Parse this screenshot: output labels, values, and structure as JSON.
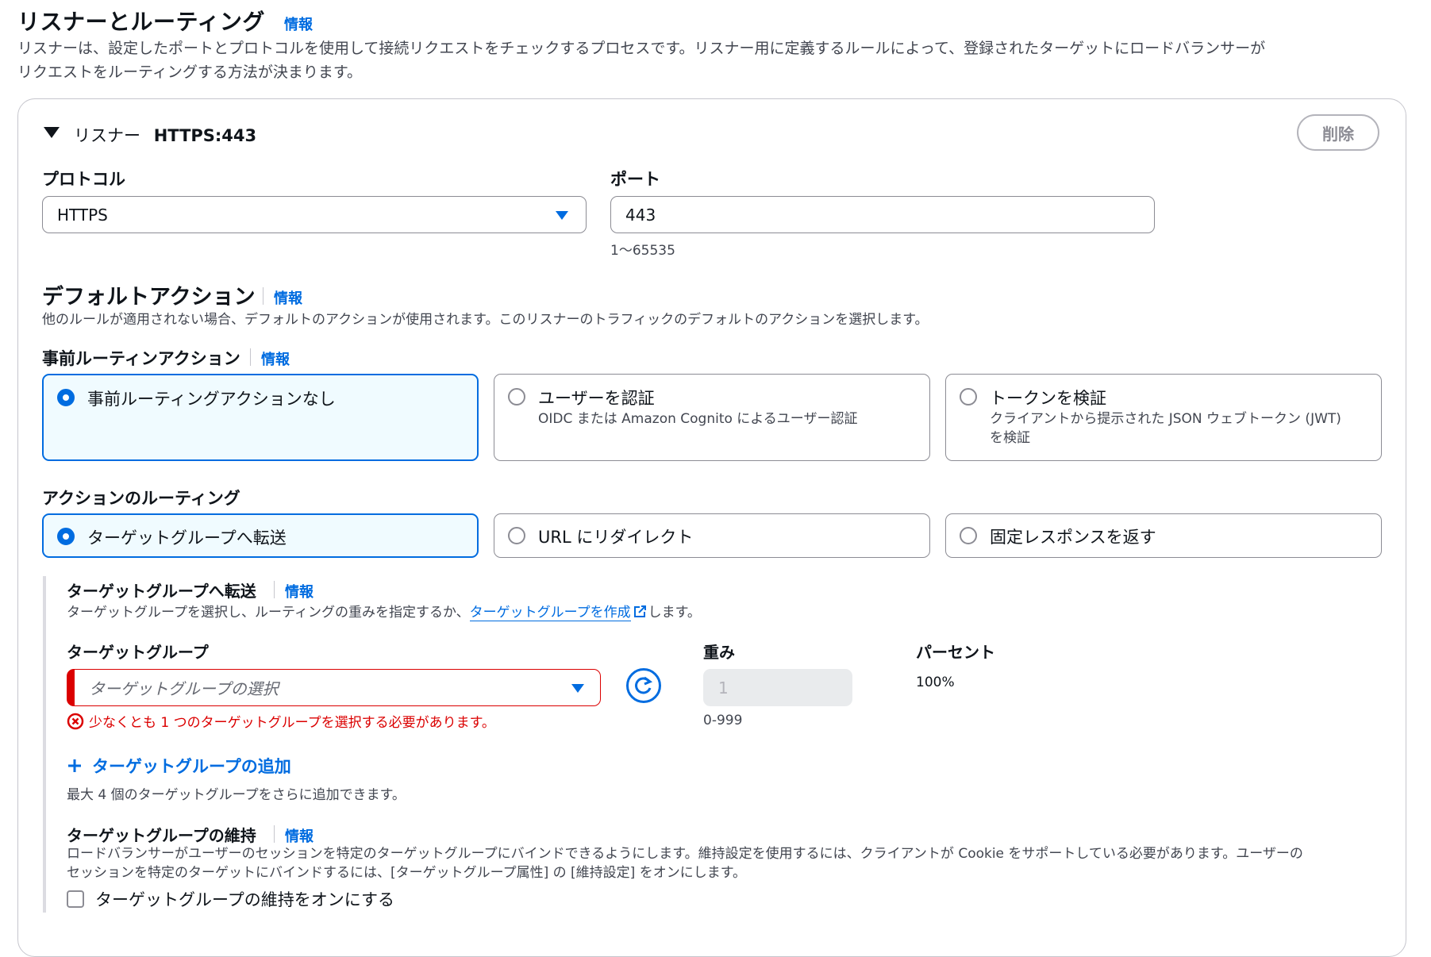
{
  "section": {
    "title": "リスナーとルーティング",
    "info": "情報",
    "description_line1": "リスナーは、設定したポートとプロトコルを使用して接続リクエストをチェックするプロセスです。リスナー用に定義するルールによって、登録されたターゲットにロードバランサーが",
    "description_line2": "リクエストをルーティングする方法が決まります。"
  },
  "listener": {
    "prefix": "リスナー",
    "name": "HTTPS:443",
    "delete_label": "削除",
    "protocol_label": "プロトコル",
    "protocol_value": "HTTPS",
    "port_label": "ポート",
    "port_value": "443",
    "port_hint": "1〜65535"
  },
  "default_action": {
    "title": "デフォルトアクション",
    "info": "情報",
    "description": "他のルールが適用されない場合、デフォルトのアクションが使用されます。このリスナーのトラフィックのデフォルトのアクションを選択します。"
  },
  "pre_routing": {
    "label": "事前ルーティンアクション",
    "info": "情報",
    "options": [
      {
        "title": "事前ルーティングアクションなし",
        "desc": "",
        "selected": true
      },
      {
        "title": "ユーザーを認証",
        "desc": "OIDC または Amazon Cognito によるユーザー認証",
        "selected": false
      },
      {
        "title": "トークンを検証",
        "desc": "クライアントから提示された JSON ウェブトークン (JWT)",
        "desc2": "を検証",
        "selected": false
      }
    ]
  },
  "routing": {
    "label": "アクションのルーティング",
    "options": [
      {
        "title": "ターゲットグループへ転送",
        "selected": true
      },
      {
        "title": "URL にリダイレクト",
        "selected": false
      },
      {
        "title": "固定レスポンスを返す",
        "selected": false
      }
    ]
  },
  "forward": {
    "title": "ターゲットグループへ転送",
    "info": "情報",
    "desc_before": "ターゲットグループを選択し、ルーティングの重みを指定するか、",
    "create_link": "ターゲットグループを作成",
    "desc_after": "します。",
    "tg_label": "ターゲットグループ",
    "tg_placeholder": "ターゲットグループの選択",
    "tg_error": "少なくとも 1 つのターゲットグループを選択する必要があります。",
    "weight_label": "重み",
    "weight_value": "1",
    "weight_hint": "0-999",
    "percent_label": "パーセント",
    "percent_value": "100%",
    "add_label": "ターゲットグループの追加",
    "add_hint": "最大 4 個のターゲットグループをさらに追加できます。"
  },
  "stickiness": {
    "title": "ターゲットグループの維持",
    "info": "情報",
    "desc_line1": "ロードバランサーがユーザーのセッションを特定のターゲットグループにバインドできるようにします。維持設定を使用するには、クライアントが Cookie をサポートしている必要があります。ユーザーの",
    "desc_line2": "セッションを特定のターゲットにバインドするには、[ターゲットグループ属性] の [維持設定] をオンにします。",
    "checkbox_label": "ターゲットグループの維持をオンにする"
  },
  "colors": {
    "accent": "#006ce0",
    "error": "#db0000",
    "selected_bg": "#f0fbff"
  }
}
